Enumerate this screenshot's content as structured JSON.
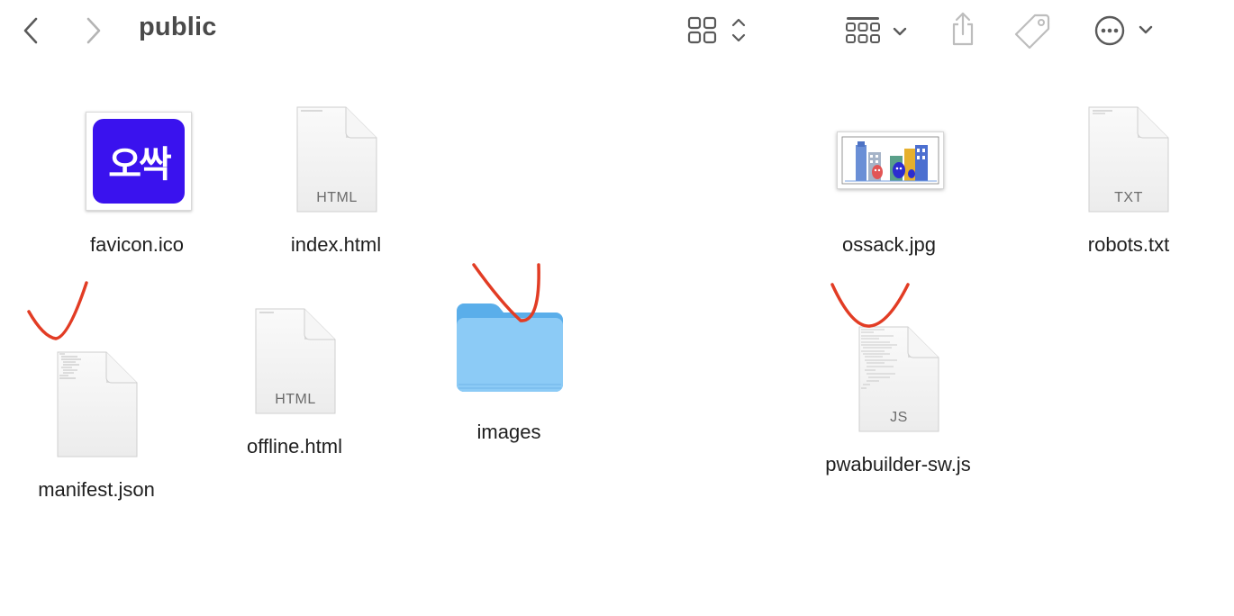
{
  "window": {
    "title": "public"
  },
  "toolbar": {
    "back_icon": "chevron-left-icon",
    "forward_icon": "chevron-right-icon",
    "view_icon": "icon-grid-view-icon",
    "group_icon": "group-by-icon",
    "share_icon": "share-icon",
    "tag_icon": "tag-icon",
    "more_icon": "ellipsis-circle-icon"
  },
  "files": [
    {
      "name": "favicon.ico",
      "kind": "ico",
      "thumb_text": "오싹"
    },
    {
      "name": "index.html",
      "kind": "document",
      "ext": "HTML"
    },
    {
      "name": "ossack.jpg",
      "kind": "jpg"
    },
    {
      "name": "robots.txt",
      "kind": "document",
      "ext": "TXT"
    },
    {
      "name": "manifest.json",
      "kind": "document",
      "ext": ""
    },
    {
      "name": "offline.html",
      "kind": "document",
      "ext": "HTML"
    },
    {
      "name": "images",
      "kind": "folder"
    },
    {
      "name": "pwabuilder-sw.js",
      "kind": "document",
      "ext": "JS"
    }
  ],
  "colors": {
    "folder_back": "#5aaeea",
    "folder_front": "#8ccbf6",
    "ico_background": "#3a12ee",
    "annotation": "#e23c24"
  }
}
